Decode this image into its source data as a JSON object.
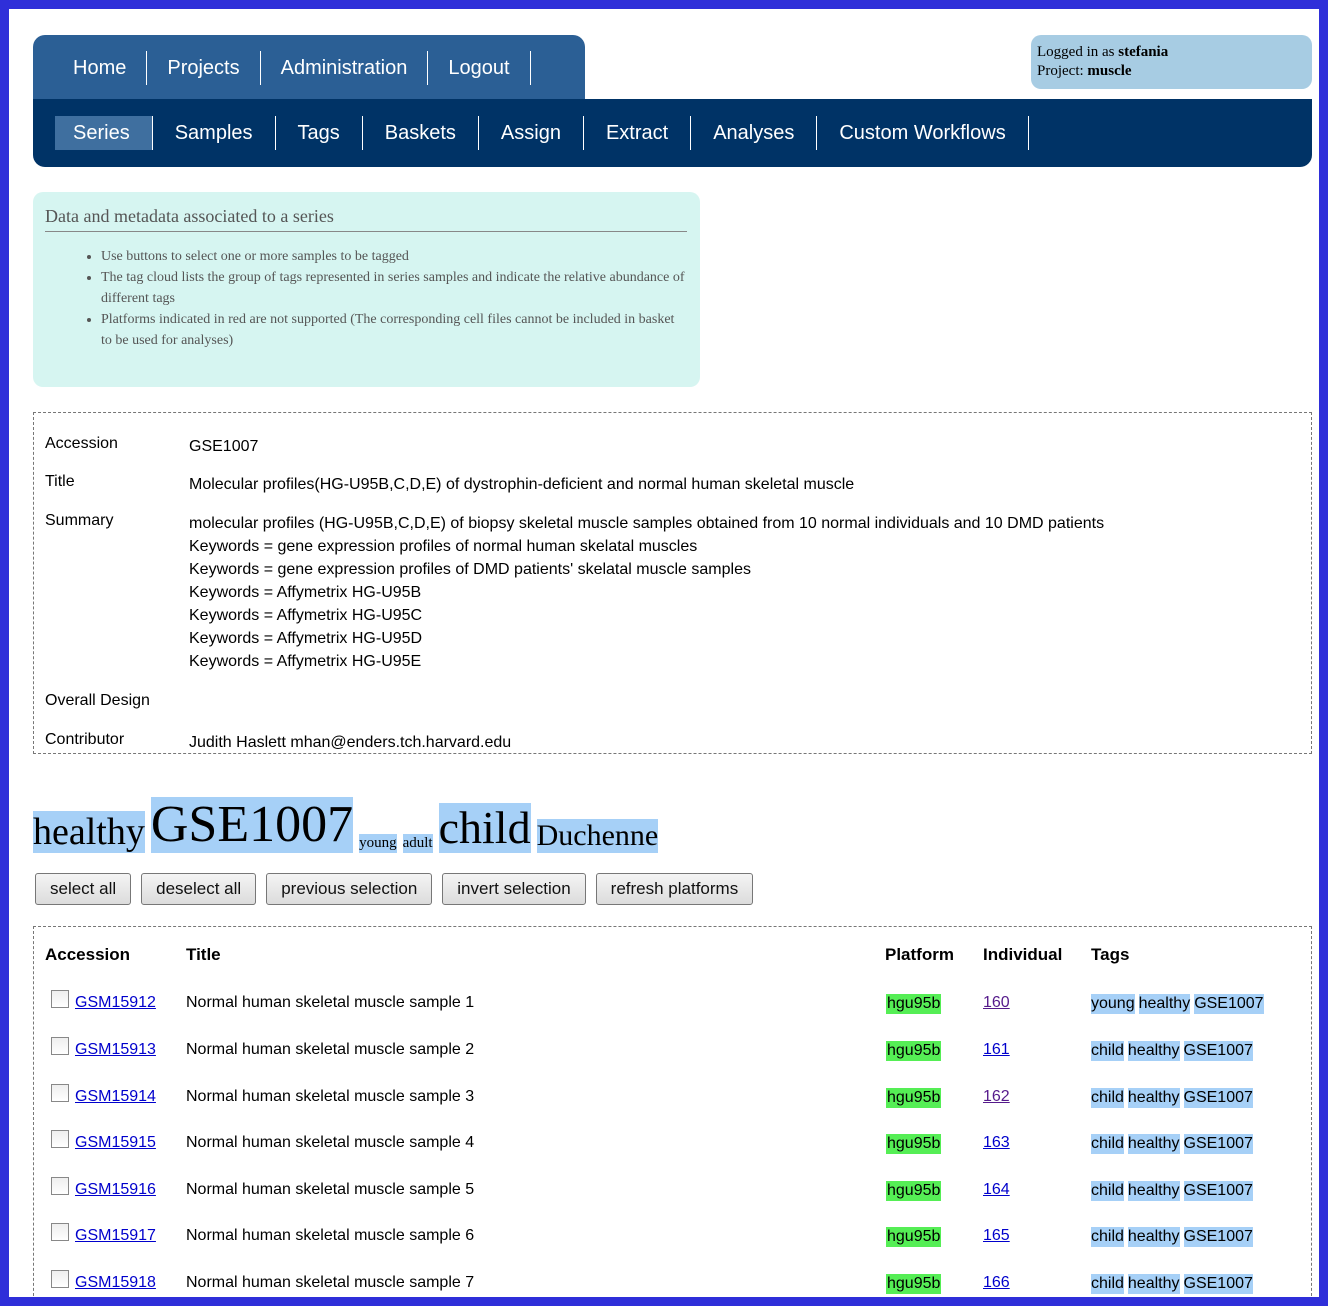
{
  "nav": {
    "top": [
      "Home",
      "Projects",
      "Administration",
      "Logout"
    ],
    "sub": [
      "Series",
      "Samples",
      "Tags",
      "Baskets",
      "Assign",
      "Extract",
      "Analyses",
      "Custom Workflows"
    ],
    "active_sub": "Series"
  },
  "login": {
    "logged_in_prefix": "Logged in as",
    "user": "stefania",
    "project_prefix": "Project:",
    "project": "muscle"
  },
  "info": {
    "heading": "Data and metadata associated to a series",
    "bullets": [
      "Use buttons to select one or more samples to be tagged",
      "The tag cloud lists the group of tags represented in series samples and indicate the relative abundance of different tags",
      "Platforms indicated in red are not supported (The corresponding cell files cannot be included in basket to be used for analyses)"
    ]
  },
  "details": {
    "accession_label": "Accession",
    "accession": "GSE1007",
    "title_label": "Title",
    "title": "Molecular profiles(HG-U95B,C,D,E) of dystrophin-deficient and normal human skeletal muscle",
    "summary_label": "Summary",
    "summary": [
      "molecular profiles (HG-U95B,C,D,E) of biopsy skeletal muscle samples obtained from 10 normal individuals and 10 DMD patients",
      "Keywords = gene expression profiles of normal human skelatal muscles",
      "Keywords = gene expression profiles of DMD patients' skelatal muscle samples",
      "Keywords = Affymetrix HG-U95B",
      "Keywords = Affymetrix HG-U95C",
      "Keywords = Affymetrix HG-U95D",
      "Keywords = Affymetrix HG-U95E"
    ],
    "design_label": "Overall Design",
    "design": "",
    "contributor_label": "Contributor",
    "contributor": "Judith Haslett mhan@enders.tch.harvard.edu"
  },
  "tag_cloud": [
    "healthy",
    "GSE1007",
    "young",
    "adult",
    "child",
    "Duchenne"
  ],
  "buttons": [
    "select all",
    "deselect all",
    "previous selection",
    "invert selection",
    "refresh platforms"
  ],
  "table": {
    "headers": [
      "Accession",
      "Title",
      "Platform",
      "Individual",
      "Tags"
    ],
    "rows": [
      {
        "accession": "GSM15912",
        "title": "Normal human skeletal muscle sample 1",
        "platform": "hgu95b",
        "individual": "160",
        "tags": [
          "young",
          "healthy",
          "GSE1007"
        ]
      },
      {
        "accession": "GSM15913",
        "title": "Normal human skeletal muscle sample 2",
        "platform": "hgu95b",
        "individual": "161",
        "tags": [
          "child",
          "healthy",
          "GSE1007"
        ]
      },
      {
        "accession": "GSM15914",
        "title": "Normal human skeletal muscle sample 3",
        "platform": "hgu95b",
        "individual": "162",
        "tags": [
          "child",
          "healthy",
          "GSE1007"
        ]
      },
      {
        "accession": "GSM15915",
        "title": "Normal human skeletal muscle sample 4",
        "platform": "hgu95b",
        "individual": "163",
        "tags": [
          "child",
          "healthy",
          "GSE1007"
        ]
      },
      {
        "accession": "GSM15916",
        "title": "Normal human skeletal muscle sample 5",
        "platform": "hgu95b",
        "individual": "164",
        "tags": [
          "child",
          "healthy",
          "GSE1007"
        ]
      },
      {
        "accession": "GSM15917",
        "title": "Normal human skeletal muscle sample 6",
        "platform": "hgu95b",
        "individual": "165",
        "tags": [
          "child",
          "healthy",
          "GSE1007"
        ]
      },
      {
        "accession": "GSM15918",
        "title": "Normal human skeletal muscle sample 7",
        "platform": "hgu95b",
        "individual": "166",
        "tags": [
          "child",
          "healthy",
          "GSE1007"
        ]
      }
    ]
  },
  "colors": {
    "border": "#2f2fd9",
    "nav_top": "#2b5f95",
    "nav_sub": "#003366",
    "info_bg": "#d6f5f1",
    "tag_bg": "#a6d0f7",
    "platform_ok": "#55ee55"
  }
}
